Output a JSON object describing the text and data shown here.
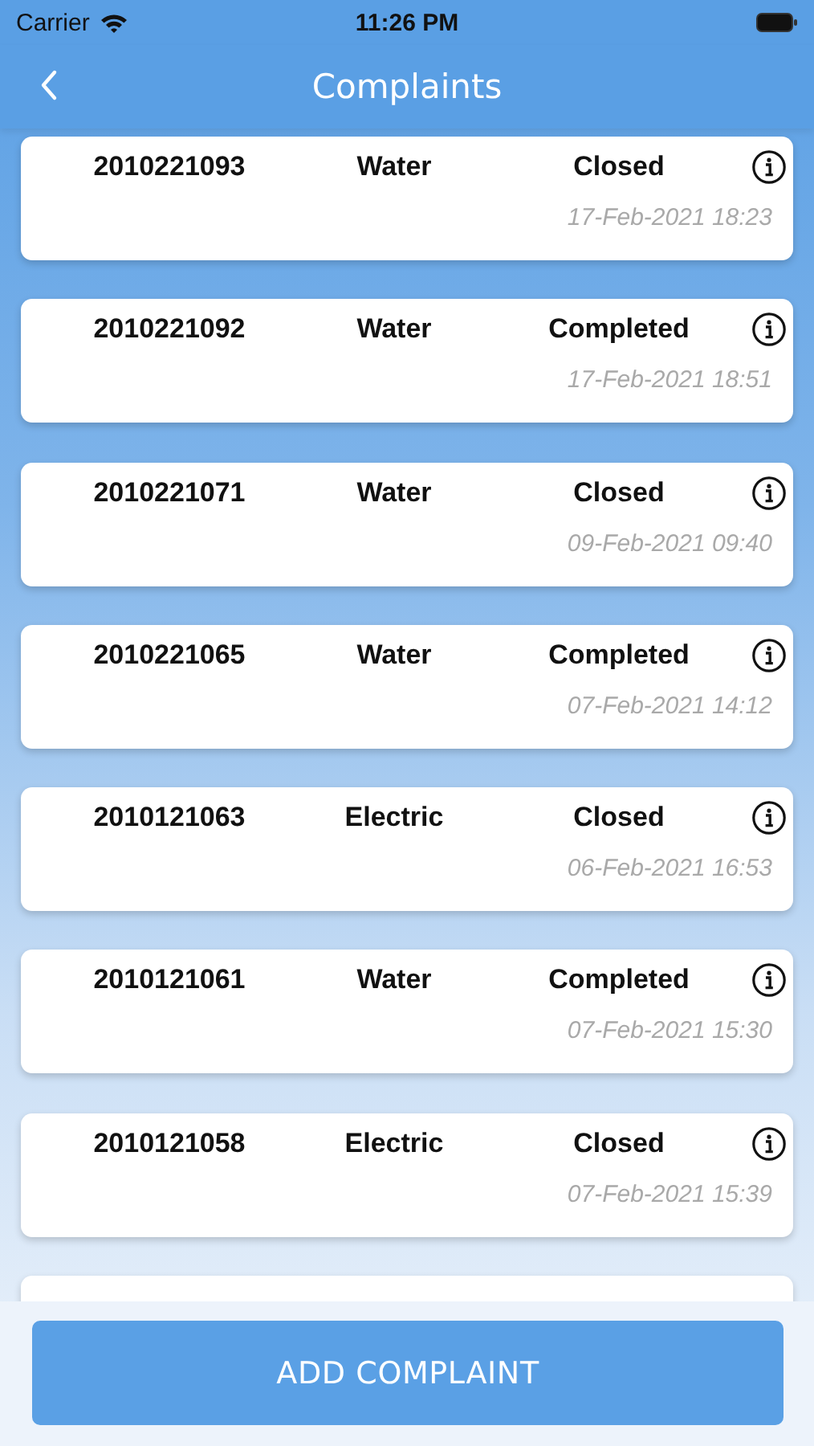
{
  "status_bar": {
    "carrier": "Carrier",
    "time": "11:26 PM"
  },
  "header": {
    "title": "Complaints"
  },
  "complaints": [
    {
      "number": "2010221093",
      "category": "Water",
      "status": "Closed",
      "date": "17-Feb-2021 18:23"
    },
    {
      "number": "2010221092",
      "category": "Water",
      "status": "Completed",
      "date": "17-Feb-2021 18:51"
    },
    {
      "number": "2010221071",
      "category": "Water",
      "status": "Closed",
      "date": "09-Feb-2021 09:40"
    },
    {
      "number": "2010221065",
      "category": "Water",
      "status": "Completed",
      "date": "07-Feb-2021 14:12"
    },
    {
      "number": "2010121063",
      "category": "Electric",
      "status": "Closed",
      "date": "06-Feb-2021 16:53"
    },
    {
      "number": "2010121061",
      "category": "Water",
      "status": "Completed",
      "date": "07-Feb-2021 15:30"
    },
    {
      "number": "2010121058",
      "category": "Electric",
      "status": "Closed",
      "date": "07-Feb-2021 15:39"
    }
  ],
  "add_button": {
    "label": "ADD COMPLAINT"
  }
}
